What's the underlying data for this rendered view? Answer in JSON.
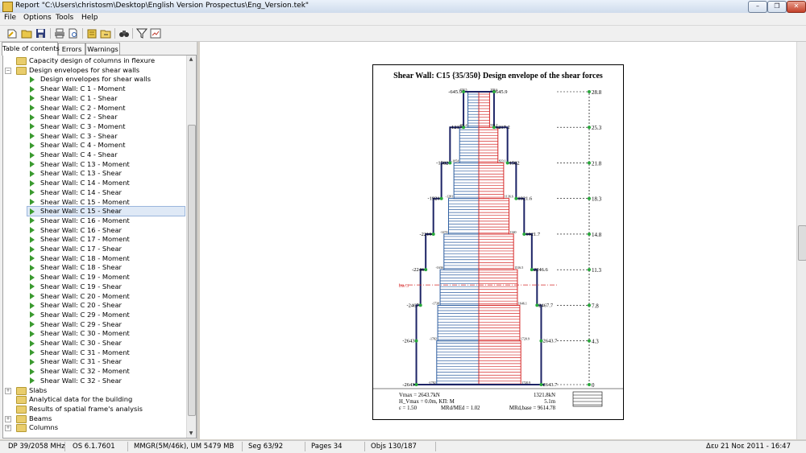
{
  "window": {
    "title": "Report \"C:\\Users\\christosm\\Desktop\\English Version Prospectus\\Eng_Version.tek\""
  },
  "menu": [
    "File",
    "Options",
    "Tools",
    "Help"
  ],
  "tabs": {
    "contents": "Table of contents",
    "errors": "Errors",
    "warnings": "Warnings"
  },
  "tree": {
    "top_item": "Capacity design of columns in flexure",
    "group": "Design envelopes for shear walls",
    "children": [
      "Design envelopes for shear walls",
      "Shear Wall: C 1 - Moment",
      "Shear Wall: C 1 - Shear",
      "Shear Wall: C 2 - Moment",
      "Shear Wall: C 2 - Shear",
      "Shear Wall: C 3 - Moment",
      "Shear Wall: C 3 - Shear",
      "Shear Wall: C 4 - Moment",
      "Shear Wall: C 4 - Shear",
      "Shear Wall: C 13 - Moment",
      "Shear Wall: C 13 - Shear",
      "Shear Wall: C 14 - Moment",
      "Shear Wall: C 14 - Shear",
      "Shear Wall: C 15 - Moment",
      "Shear Wall: C 15 - Shear",
      "Shear Wall: C 16 - Moment",
      "Shear Wall: C 16 - Shear",
      "Shear Wall: C 17 - Moment",
      "Shear Wall: C 17 - Shear",
      "Shear Wall: C 18 - Moment",
      "Shear Wall: C 18 - Shear",
      "Shear Wall: C 19 - Moment",
      "Shear Wall: C 19 - Shear",
      "Shear Wall: C 20 - Moment",
      "Shear Wall: C 20 - Shear",
      "Shear Wall: C 29 - Moment",
      "Shear Wall: C 29 - Shear",
      "Shear Wall: C 30 - Moment",
      "Shear Wall: C 30 - Shear",
      "Shear Wall: C 31 - Moment",
      "Shear Wall: C 31 - Shear",
      "Shear Wall: C 32 - Moment",
      "Shear Wall: C 32 - Shear"
    ],
    "selected": "Shear Wall: C 15 - Shear",
    "after": [
      "Slabs",
      "Analytical data for the building",
      "Results of spatial frame's analysis",
      "Beams",
      "Columns"
    ]
  },
  "report": {
    "title": "Shear Wall: C15 {35/350} Design envelope of the shear forces",
    "hw_label": "hw/3",
    "footer": {
      "vmax": "Vmax = 2643.7kN",
      "hvmax": "H_Vmax = 0.0m, ΚΠ: M",
      "eps": "ε = 1.50",
      "ratio": "MRd/MEd = 1.02",
      "v2": "1321.8kN",
      "h2": "5.1m",
      "mrd": "MRd,base = 9614.78"
    }
  },
  "chart_data": {
    "type": "bar",
    "title": "Shear Wall: C15 {35/350} Design envelope of the shear forces",
    "levels_m": [
      0,
      4.3,
      7.8,
      11.3,
      14.8,
      18.3,
      21.8,
      25.3,
      28.8
    ],
    "level_labels": [
      "0",
      "4.3",
      "7.8",
      "11.3",
      "14.8",
      "18.3",
      "21.8",
      "25.3",
      "28.8"
    ],
    "envelope_values_kN": [
      2643.7,
      2643.7,
      2467.7,
      2246.6,
      1921.7,
      1582,
      1217.2,
      645.9
    ],
    "value_labels_left": [
      "-2643",
      "-2643",
      "-2467",
      "-2246",
      "-2219",
      "-1921",
      "-1582",
      "-1217",
      "-645.9"
    ],
    "value_labels_right": [
      "2643.7",
      "2643.7",
      "2467.7",
      "2246.6",
      "1921.7",
      "1921.6",
      "1582",
      "1217.2",
      "645.9"
    ],
    "design_labels_right": [
      "1720.9",
      "1720.9",
      "1646.1",
      "1516.5",
      "1340",
      "1136.6",
      "823.1",
      "534.7",
      "208.6"
    ],
    "design_labels_left": [
      "-1782",
      "-1782",
      "-1738",
      "-1636",
      "-1474",
      "-1281",
      "-1054",
      "-811.4",
      "-458.5"
    ],
    "design_values_kN": [
      1782,
      1738,
      1636,
      1474,
      1281,
      1054,
      811.4,
      458.5
    ],
    "hw3_m": 9.8,
    "xlim": [
      -3000,
      3000
    ]
  },
  "status": {
    "dp": "DP 39/2058 MHz",
    "os": "OS 6.1.7601",
    "mem": "MMGR(5M/46k), UM 5479 MB",
    "seg": "Seg 63/92",
    "pages": "Pages 34",
    "objs": "Objs 130/187",
    "date": "Δευ 21 Νοε 2011 - 16:47"
  }
}
